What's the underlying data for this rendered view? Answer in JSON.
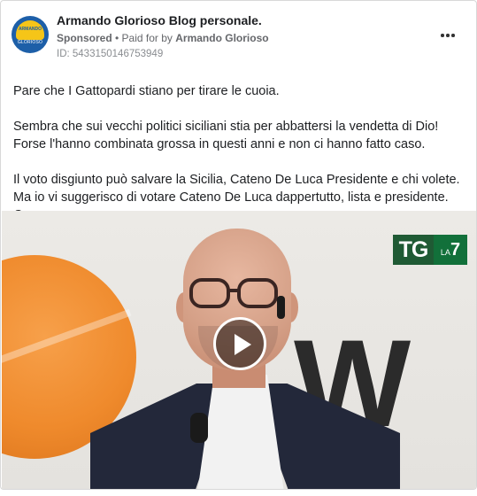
{
  "header": {
    "page_name": "Armando Glorioso Blog personale.",
    "sponsored_label": "Sponsored",
    "paid_for_prefix": " • Paid for by ",
    "advertiser": "Armando Glorioso",
    "ad_id": "ID: 5433150146753949",
    "more_icon": "more-horizontal-icon"
  },
  "avatar": {
    "logo_text_top": "ARMANDO",
    "logo_text_bottom": "GLORIOSO"
  },
  "post": {
    "paragraphs": [
      "Pare che I Gattopardi stiano per tirare le cuoia.",
      "Sembra che sui vecchi politici siciliani stia per abbattersi la vendetta di Dio! Forse l'hanno combinata grossa in questi anni e non ci hanno fatto caso.",
      "Il voto disgiunto può salvare la Sicilia, Cateno De Luca Presidente e chi volete. Ma io vi suggerisco di votare Cateno De Luca dappertutto, lista e presidente. Come…"
    ]
  },
  "video": {
    "channel_logo_tg": "TG",
    "channel_logo_la": "LA",
    "channel_logo_7": "7",
    "background_letters": "W",
    "play_icon": "play-icon"
  },
  "colors": {
    "text_primary": "#1c1e21",
    "text_secondary": "#65676b",
    "tg_green": "#1f5a34",
    "la7_green": "#12703a"
  }
}
